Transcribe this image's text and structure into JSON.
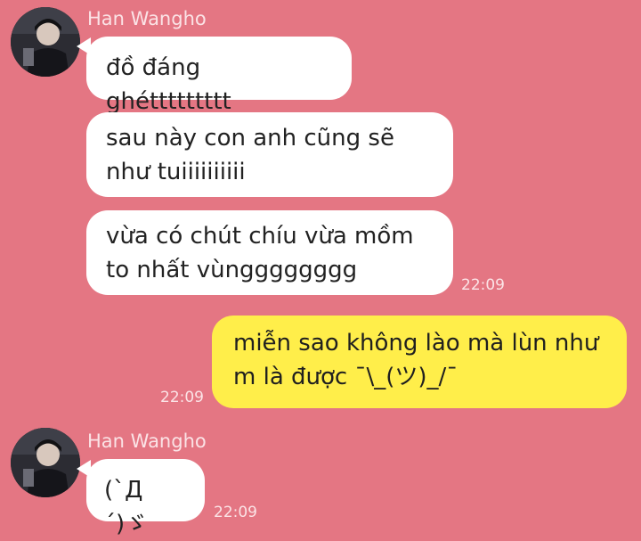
{
  "chat": {
    "groups": [
      {
        "sender": "Han Wangho",
        "messages": [
          "đồ đáng ghéttttttttt",
          "sau này con anh cũng sẽ\nnhư tuiiiiiiiiii",
          "vừa có chút chíu vừa mồm\nto nhất vùngggggggg"
        ],
        "time": "22:09"
      },
      {
        "sender": "me",
        "messages": [
          "miễn sao không lào mà lùn như\nm là được ¯\\_(ツ)_/¯"
        ],
        "time": "22:09"
      },
      {
        "sender": "Han Wangho",
        "messages": [
          "(`Д´)ゞ"
        ],
        "time": "22:09"
      }
    ]
  },
  "colors": {
    "background": "#e47683",
    "incoming_bubble": "#ffffff",
    "outgoing_bubble": "#ffee4a"
  }
}
